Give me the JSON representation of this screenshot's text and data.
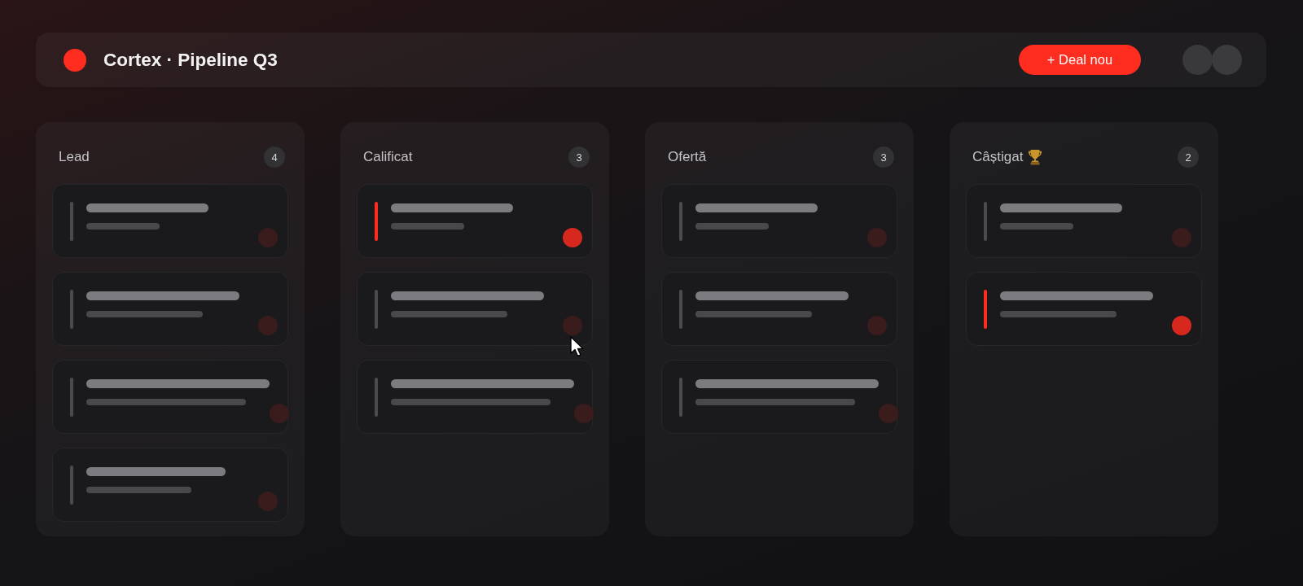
{
  "header": {
    "title": "Cortex · Pipeline Q3",
    "new_button": "+ Deal nou"
  },
  "columns": [
    {
      "title": "Lead",
      "count": "4",
      "has_icon": false,
      "cards": [
        {
          "active": false
        },
        {
          "active": false
        },
        {
          "active": false
        },
        {
          "active": false
        }
      ]
    },
    {
      "title": "Calificat",
      "count": "3",
      "has_icon": false,
      "cards": [
        {
          "active": true
        },
        {
          "active": false
        },
        {
          "active": false
        }
      ]
    },
    {
      "title": "Ofertă",
      "count": "3",
      "has_icon": false,
      "cards": [
        {
          "active": false
        },
        {
          "active": false
        },
        {
          "active": false
        }
      ]
    },
    {
      "title": "Câștigat",
      "count": "2",
      "has_icon": true,
      "cards": [
        {
          "active": false
        },
        {
          "active": true
        }
      ]
    }
  ]
}
